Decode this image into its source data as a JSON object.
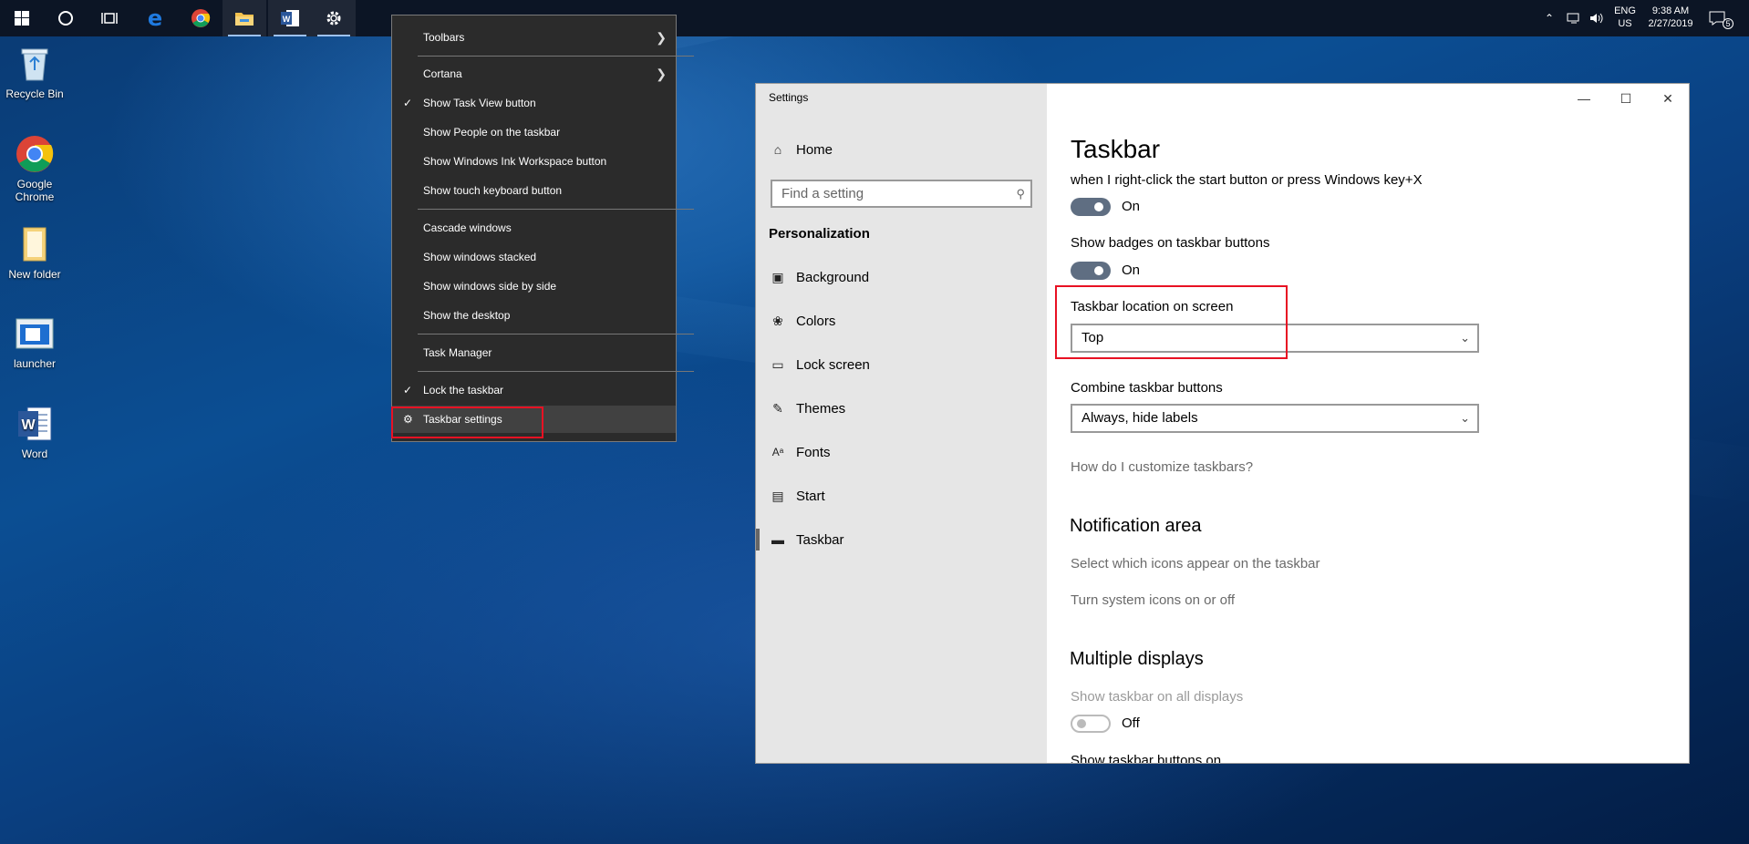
{
  "taskbar": {
    "icons": [
      "windows-start-icon",
      "cortana-icon",
      "task-view-icon",
      "edge-icon",
      "chrome-icon",
      "file-explorer-icon",
      "word-icon",
      "settings-icon"
    ],
    "tray": {
      "language_top": "ENG",
      "language_bottom": "US",
      "time": "9:38 AM",
      "date": "2/27/2019",
      "notification_count": "5"
    }
  },
  "desktop": {
    "icons": [
      {
        "label_line1": "Recycle Bin",
        "label_line2": ""
      },
      {
        "label_line1": "Google",
        "label_line2": "Chrome"
      },
      {
        "label_line1": "New folder",
        "label_line2": ""
      },
      {
        "label_line1": "launcher",
        "label_line2": ""
      },
      {
        "label_line1": "Word",
        "label_line2": ""
      }
    ]
  },
  "context_menu": {
    "items": [
      {
        "label": "Toolbars"
      },
      {
        "label": "Cortana"
      },
      {
        "label": "Show Task View button",
        "checked": true
      },
      {
        "label": "Show People on the taskbar"
      },
      {
        "label": "Show Windows Ink Workspace button"
      },
      {
        "label": "Show touch keyboard button"
      },
      {
        "label": "Cascade windows"
      },
      {
        "label": "Show windows stacked"
      },
      {
        "label": "Show windows side by side"
      },
      {
        "label": "Show the desktop"
      },
      {
        "label": "Task Manager"
      },
      {
        "label": "Lock the taskbar",
        "checked": true
      },
      {
        "label": "Taskbar settings"
      }
    ]
  },
  "settings": {
    "window_title": "Settings",
    "nav": {
      "home": "Home",
      "search_placeholder": "Find a setting",
      "section": "Personalization",
      "items": [
        {
          "label": "Background"
        },
        {
          "label": "Colors"
        },
        {
          "label": "Lock screen"
        },
        {
          "label": "Themes"
        },
        {
          "label": "Fonts"
        },
        {
          "label": "Start"
        },
        {
          "label": "Taskbar"
        }
      ]
    },
    "main": {
      "title": "Taskbar",
      "winx_text": "when I right-click the start button or press Windows key+X",
      "winx_state": "On",
      "badges_label": "Show badges on taskbar buttons",
      "badges_state": "On",
      "location_label": "Taskbar location on screen",
      "location_value": "Top",
      "combine_label": "Combine taskbar buttons",
      "combine_value": "Always, hide labels",
      "customize_link": "How do I customize taskbars?",
      "notification_heading": "Notification area",
      "notif_link1": "Select which icons appear on the taskbar",
      "notif_link2": "Turn system icons on or off",
      "multiple_heading": "Multiple displays",
      "show_all_label": "Show taskbar on all displays",
      "show_all_state": "Off",
      "buttons_on_label": "Show taskbar buttons on"
    }
  }
}
